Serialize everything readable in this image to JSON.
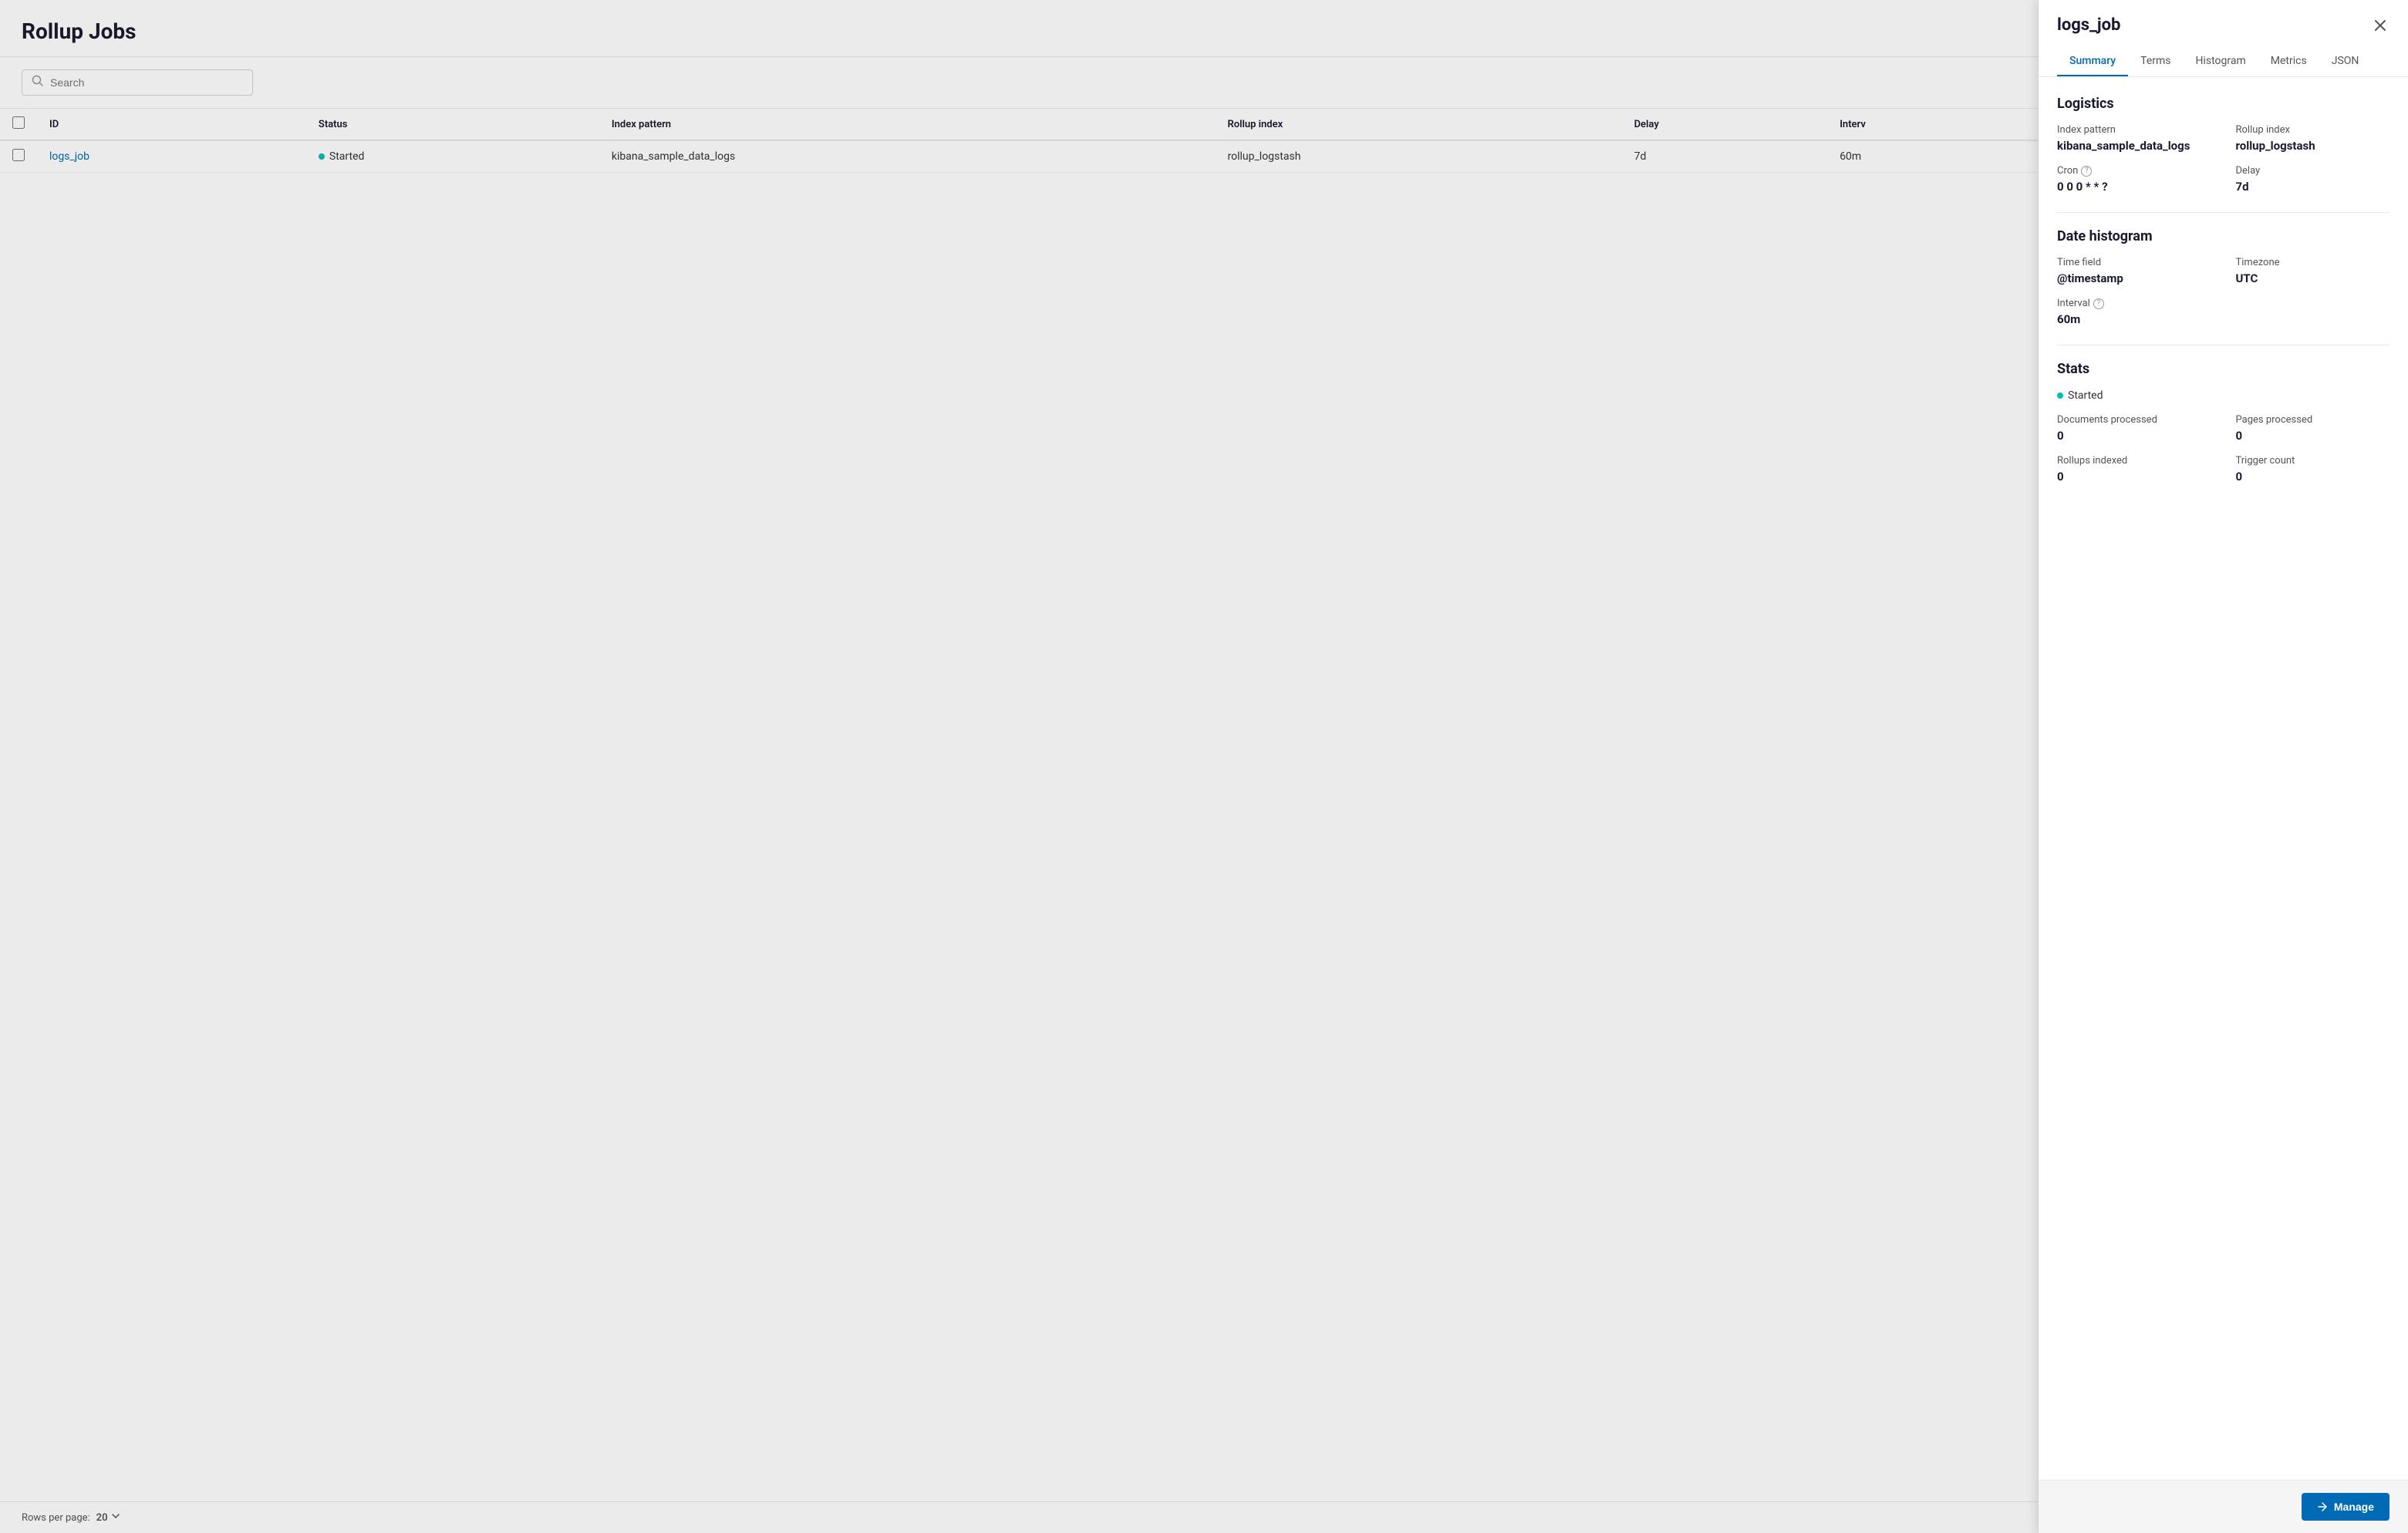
{
  "page": {
    "title": "Rollup Jobs"
  },
  "toolbar": {
    "search_placeholder": "Search"
  },
  "table": {
    "columns": [
      "ID",
      "Status",
      "Index pattern",
      "Rollup index",
      "Delay",
      "Interv"
    ],
    "rows": [
      {
        "id": "logs_job",
        "status": "Started",
        "index_pattern": "kibana_sample_data_logs",
        "rollup_index": "rollup_logstash",
        "delay": "7d",
        "interval": "60m"
      }
    ]
  },
  "footer": {
    "rows_per_page_label": "Rows per page:",
    "rows_per_page_value": "20"
  },
  "detail": {
    "job_name": "logs_job",
    "tabs": [
      "Summary",
      "Terms",
      "Histogram",
      "Metrics",
      "JSON"
    ],
    "active_tab": "Summary",
    "logistics": {
      "section_title": "Logistics",
      "index_pattern_label": "Index pattern",
      "index_pattern_value": "kibana_sample_data_logs",
      "rollup_index_label": "Rollup index",
      "rollup_index_value": "rollup_logstash",
      "cron_label": "Cron",
      "cron_value": "0 0 0 * * ?",
      "delay_label": "Delay",
      "delay_value": "7d"
    },
    "date_histogram": {
      "section_title": "Date histogram",
      "time_field_label": "Time field",
      "time_field_value": "@timestamp",
      "timezone_label": "Timezone",
      "timezone_value": "UTC",
      "interval_label": "Interval",
      "interval_value": "60m"
    },
    "stats": {
      "section_title": "Stats",
      "status": "Started",
      "documents_processed_label": "Documents processed",
      "documents_processed_value": "0",
      "pages_processed_label": "Pages processed",
      "pages_processed_value": "0",
      "rollups_indexed_label": "Rollups indexed",
      "rollups_indexed_value": "0",
      "trigger_count_label": "Trigger count",
      "trigger_count_value": "0"
    },
    "manage_button": "Manage"
  }
}
